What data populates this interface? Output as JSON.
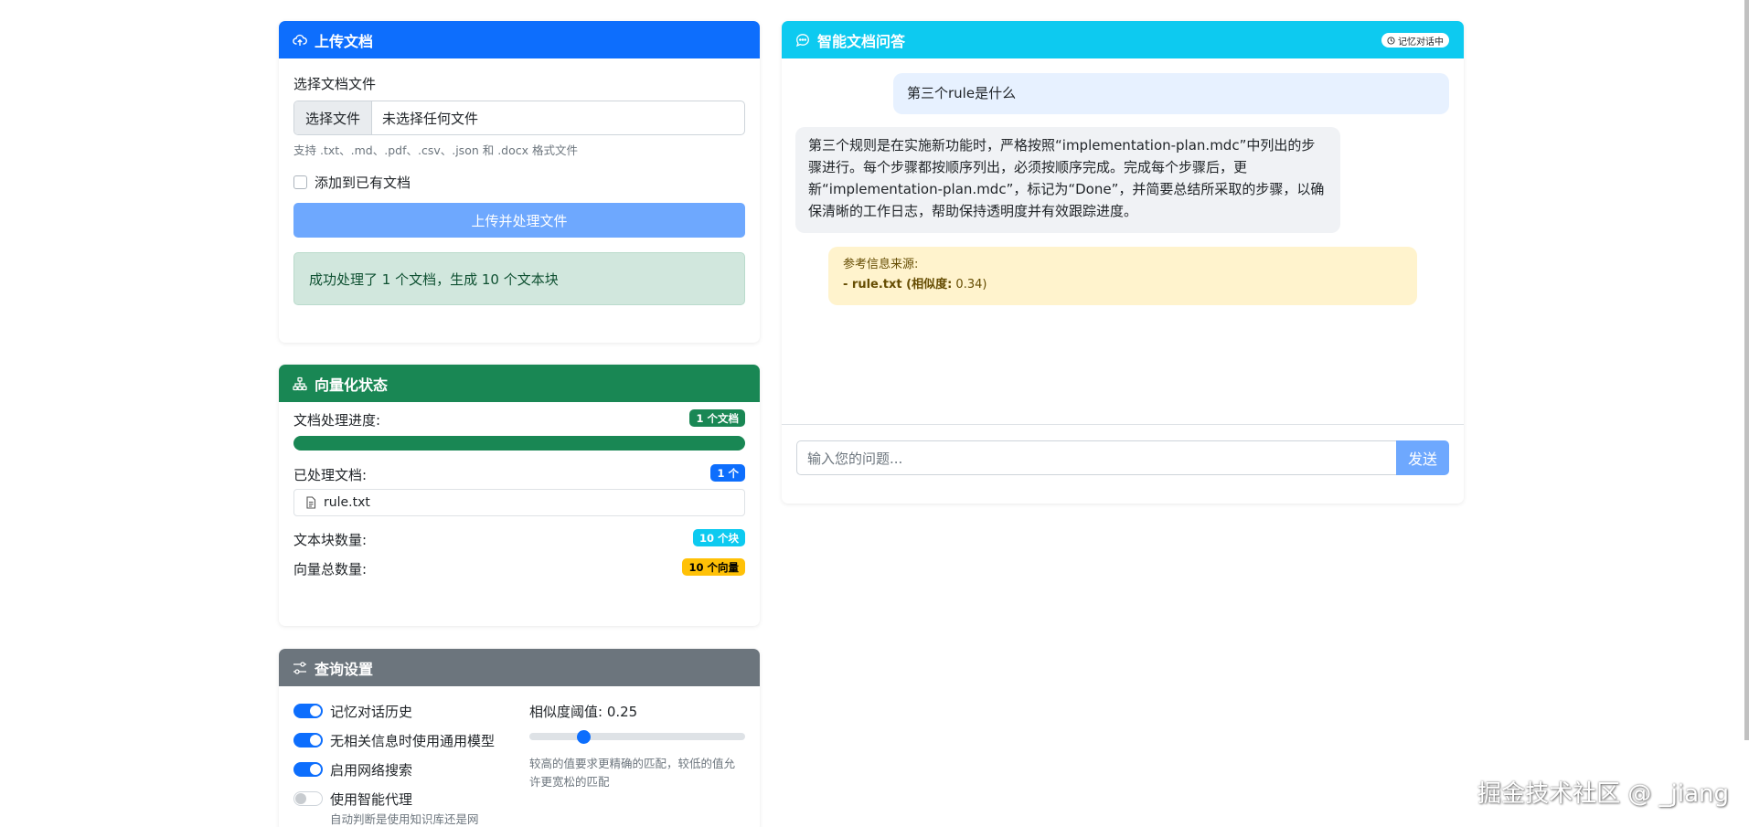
{
  "upload_card": {
    "title": "上传文档",
    "select_label": "选择文档文件",
    "file_button": "选择文件",
    "file_status": "未选择任何文件",
    "help_text": "支持 .txt、.md、.pdf、.csv、.json 和 .docx 格式文件",
    "append_checkbox_label": "添加到已有文档",
    "append_checked": false,
    "upload_button": "上传并处理文件",
    "success_message": "成功处理了 1 个文档，生成 10 个文本块"
  },
  "vector_card": {
    "title": "向量化状态",
    "progress_label": "文档处理进度:",
    "progress_badge": "1 个文档",
    "progress_percent": 100,
    "processed_label": "已处理文档:",
    "processed_badge": "1 个",
    "documents": [
      "rule.txt"
    ],
    "chunks_label": "文本块数量:",
    "chunks_badge": "10 个块",
    "vectors_label": "向量总数量:",
    "vectors_badge": "10 个向量"
  },
  "query_card": {
    "title": "查询设置",
    "toggles": [
      {
        "label": "记忆对话历史",
        "on": true
      },
      {
        "label": "无相关信息时使用通用模型",
        "on": true
      },
      {
        "label": "启用网络搜索",
        "on": true
      },
      {
        "label": "使用智能代理",
        "on": false
      }
    ],
    "agent_help": "自动判断是使用知识库还是网",
    "threshold_label": "相似度阈值: 0.25",
    "threshold_value": 0.25,
    "threshold_help": "较高的值要求更精确的匹配，较低的值允许更宽松的匹配"
  },
  "chat_card": {
    "title": "智能文档问答",
    "memory_badge": "记忆对话中",
    "messages": [
      {
        "role": "user",
        "text": "第三个rule是什么"
      },
      {
        "role": "assistant",
        "text": "第三个规则是在实施新功能时，严格按照“implementation-plan.mdc”中列出的步骤进行。每个步骤都按顺序列出，必须按顺序完成。完成每个步骤后，更新“implementation-plan.mdc”，标记为“Done”，并简要总结所采取的步骤，以确保清晰的工作日志，帮助保持透明度并有效跟踪进度。"
      }
    ],
    "sources_title": "参考信息来源:",
    "source_prefix": "- rule.txt (相似度:",
    "source_score": "0.34)",
    "input_placeholder": "输入您的问题...",
    "send_button": "发送"
  },
  "watermark": "掘金技术社区 @ _jiang",
  "colors": {
    "primary": "#0d6efd",
    "success": "#198754",
    "secondary": "#6c757d",
    "info": "#0dcaf0",
    "warning": "#ffc107"
  }
}
